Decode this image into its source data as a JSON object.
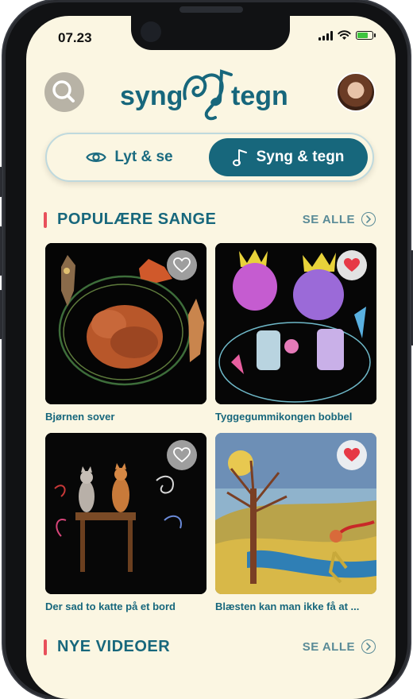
{
  "status_bar": {
    "time": "07.23"
  },
  "header": {
    "logo_text_left": "syng",
    "logo_text_right": "tegn"
  },
  "mode_toggle": {
    "options": [
      {
        "label": "Lyt & se",
        "icon": "eye-icon",
        "selected": false
      },
      {
        "label": "Syng & tegn",
        "icon": "music-note-icon",
        "selected": true
      }
    ]
  },
  "sections": [
    {
      "title": "POPULÆRE SANGE",
      "see_all": "SE ALLE",
      "songs": [
        {
          "title": "Bjørnen sover",
          "favorite": false
        },
        {
          "title": "Tyggegummikongen bobbel",
          "favorite": true
        },
        {
          "title": "Der sad to katte på et bord",
          "favorite": false
        },
        {
          "title": "Blæsten kan man ikke få at ...",
          "favorite": true
        }
      ]
    },
    {
      "title": "NYE VIDEOER",
      "see_all": "SE ALLE"
    }
  ],
  "colors": {
    "background": "#fbf6e2",
    "primary": "#17677c",
    "accent_bar": "#e8505b",
    "heart": "#e63946"
  }
}
